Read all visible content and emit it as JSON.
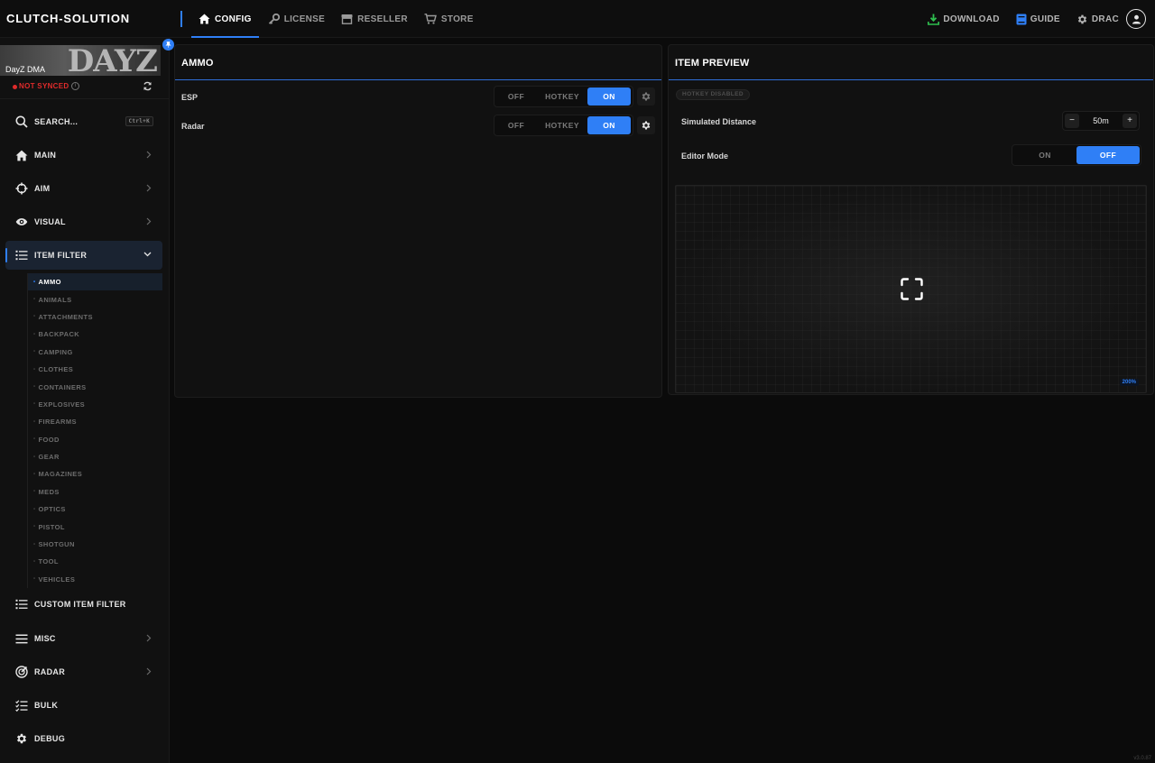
{
  "app": {
    "brand": "CLUTCH-SOLUTION",
    "version": "v3.0.87"
  },
  "topnav": {
    "items": [
      {
        "label": "CONFIG",
        "icon": "home-icon",
        "active": true
      },
      {
        "label": "LICENSE",
        "icon": "key-icon"
      },
      {
        "label": "RESELLER",
        "icon": "store-icon"
      },
      {
        "label": "STORE",
        "icon": "cart-icon"
      }
    ],
    "right": {
      "download": "DOWNLOAD",
      "guide": "GUIDE",
      "user": "DRAC"
    }
  },
  "sidebar": {
    "game": {
      "name": "DayZ DMA",
      "logo": "DAYZ"
    },
    "sync_status": "NOT SYNCED",
    "search": {
      "label": "SEARCH...",
      "shortcut": "Ctrl+K"
    },
    "items": {
      "main": "MAIN",
      "aim": "AIM",
      "visual": "VISUAL",
      "item_filter": "ITEM FILTER",
      "custom_item_filter": "CUSTOM ITEM FILTER",
      "misc": "MISC",
      "radar": "RADAR",
      "bulk": "BULK",
      "debug": "DEBUG"
    },
    "item_filter_children": [
      "AMMO",
      "ANIMALS",
      "ATTACHMENTS",
      "BACKPACK",
      "CAMPING",
      "CLOTHES",
      "CONTAINERS",
      "EXPLOSIVES",
      "FIREARMS",
      "FOOD",
      "GEAR",
      "MAGAZINES",
      "MEDS",
      "OPTICS",
      "PISTOL",
      "SHOTGUN",
      "TOOL",
      "VEHICLES"
    ],
    "active_child": "AMMO"
  },
  "ammo_panel": {
    "title": "AMMO",
    "rows": [
      {
        "label": "ESP",
        "options": [
          "OFF",
          "HOTKEY",
          "ON"
        ],
        "selected": "ON"
      },
      {
        "label": "Radar",
        "options": [
          "OFF",
          "HOTKEY",
          "ON"
        ],
        "selected": "ON"
      }
    ]
  },
  "preview_panel": {
    "title": "ITEM PREVIEW",
    "hotkey_badge": "HOTKEY DISABLED",
    "distance": {
      "label": "Simulated Distance",
      "value": "50m",
      "minus": "−",
      "plus": "+"
    },
    "editor": {
      "label": "Editor Mode",
      "on": "ON",
      "off": "OFF",
      "selected": "OFF"
    },
    "canvas_badge": "200%"
  },
  "colors": {
    "accent": "#2f7ff6",
    "danger": "#e02b2b",
    "download": "#2fbf4f"
  }
}
